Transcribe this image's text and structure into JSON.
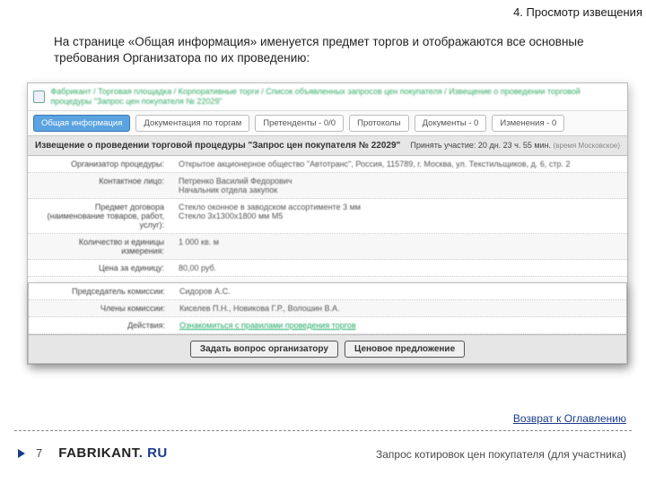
{
  "header": {
    "title": "4. Просмотр извещения"
  },
  "intro": "На странице «Общая информация» именуется предмет торгов и отображаются все основные требования Организатора по их проведению:",
  "breadcrumb": "Фабрикант / Торговая площадка / Корпоративные торги / Список объявленных запросов цен покупателя / Извещение о проведении торговой процедуры \"Запрос цен покупателя № 22029\"",
  "tabs": [
    {
      "label": "Общая информация",
      "active": true
    },
    {
      "label": "Документация по торгам"
    },
    {
      "label": "Претенденты - 0/0"
    },
    {
      "label": "Протоколы"
    },
    {
      "label": "Документы - 0"
    },
    {
      "label": "Изменения - 0"
    }
  ],
  "notice": {
    "title": "Извещение о проведении торговой процедуры \"Запрос цен покупателя № 22029\"",
    "deadline": "Принять участие: 20 дн. 23 ч. 55 мин.",
    "tz": "(время Московское)"
  },
  "rows": {
    "org_label": "Организатор процедуры:",
    "org_value": "Открытое акционерное общество \"Автотранс\", Россия, 115789, г. Москва, ул. Текстильщиков, д. 6, стр. 2",
    "contact_label": "Контактное лицо:",
    "contact_value": "Петренко Василий Федорович\nНачальник отдела закупок",
    "subject_label": "Предмет договора\n(наименование товаров, работ, услуг):",
    "subject_value": "Стекло оконное в заводском ассортименте 3 мм",
    "subject_sub": "Стекло 3х1300х1800 мм М5",
    "qty_label": "Количество и единицы измерения:",
    "qty_value": "1 000 кв. м",
    "price_label": "Цена за единицу:",
    "price_value": "80,00 руб.",
    "chair_label": "Председатель комиссии:",
    "chair_value": "Сидоров А.С.",
    "members_label": "Члены комиссии:",
    "members_value": "Киселев П.Н., Новикова Г.Р., Волошин В.А.",
    "actions_label": "Действия:",
    "actions_value": "Ознакомиться с правилами проведения торгов"
  },
  "buttons": {
    "ask": "Задать вопрос организатору",
    "offer": "Ценовое предложение"
  },
  "return_link": "Возврат к Оглавлению",
  "footer": {
    "page": "7",
    "logo1": "FABRIKANT",
    "logo2": ". RU",
    "caption": "Запрос котировок цен покупателя (для участника)"
  }
}
